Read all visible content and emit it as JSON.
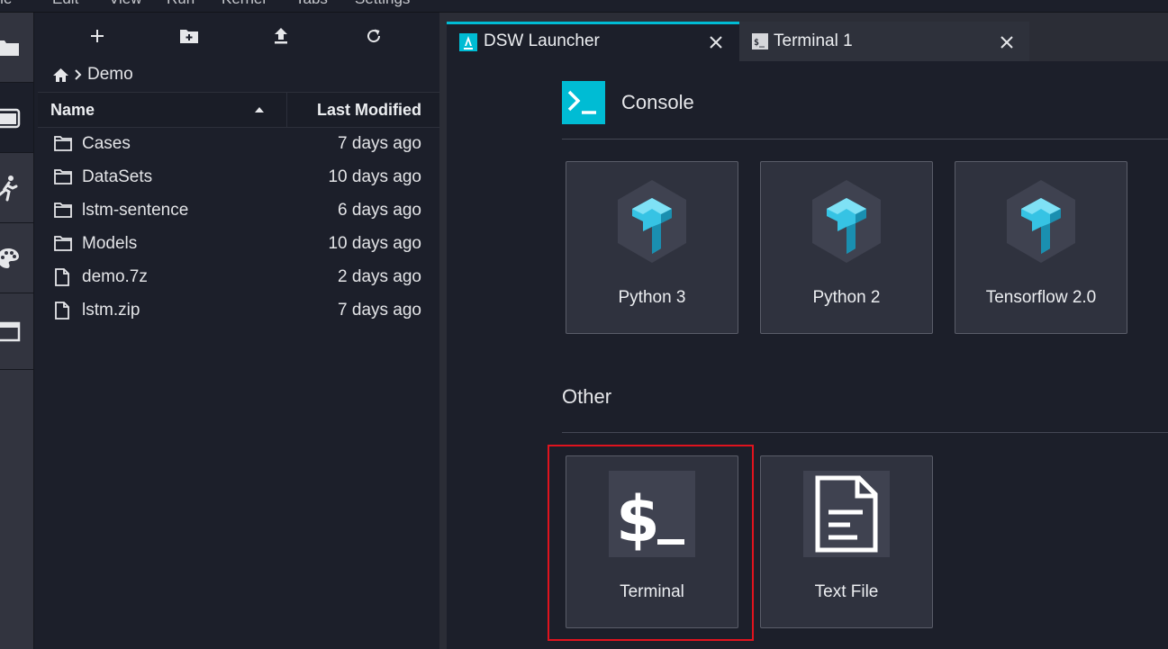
{
  "menu": [
    "File",
    "Edit",
    "View",
    "Run",
    "Kernel",
    "Tabs",
    "Settings"
  ],
  "activity_bar": [
    {
      "id": "files",
      "icon": "folder-icon"
    },
    {
      "id": "file-browser",
      "icon": "folder-tab-icon"
    },
    {
      "id": "running",
      "icon": "running-icon"
    },
    {
      "id": "commands",
      "icon": "palette-icon"
    },
    {
      "id": "tabs",
      "icon": "tabs-icon"
    }
  ],
  "file_browser": {
    "toolbar": [
      {
        "icon": "plus-icon"
      },
      {
        "icon": "new-folder-icon"
      },
      {
        "icon": "upload-icon"
      },
      {
        "icon": "refresh-icon"
      }
    ],
    "breadcrumb": {
      "home_icon": "home-icon",
      "separator_icon": "chevron-right-icon",
      "folder": "Demo"
    },
    "columns": {
      "name": "Name",
      "last_modified": "Last Modified"
    },
    "files": [
      {
        "name": "Cases",
        "modified": "7 days ago",
        "type": "folder"
      },
      {
        "name": "DataSets",
        "modified": "10 days ago",
        "type": "folder"
      },
      {
        "name": "lstm-sentence",
        "modified": "6 days ago",
        "type": "folder"
      },
      {
        "name": "Models",
        "modified": "10 days ago",
        "type": "folder"
      },
      {
        "name": "demo.7z",
        "modified": "2 days ago",
        "type": "file"
      },
      {
        "name": "lstm.zip",
        "modified": "7 days ago",
        "type": "file"
      }
    ]
  },
  "tabs": [
    {
      "label": "DSW Launcher",
      "icon": "launcher-icon",
      "active": true
    },
    {
      "label": "Terminal 1",
      "icon": "terminal-tab-icon",
      "active": false
    }
  ],
  "launcher": {
    "console": {
      "title": "Console",
      "icon": "console-icon",
      "items": [
        {
          "label": "Python 3",
          "icon": "tensorflow-icon"
        },
        {
          "label": "Python 2",
          "icon": "tensorflow-icon"
        },
        {
          "label": "Tensorflow 2.0",
          "icon": "tensorflow-icon"
        }
      ]
    },
    "other": {
      "title": "Other",
      "items": [
        {
          "label": "Terminal",
          "icon": "terminal-icon"
        },
        {
          "label": "Text File",
          "icon": "text-file-icon"
        }
      ]
    }
  },
  "colors": {
    "accent": "#00bcd4",
    "background": "#1c1f2a",
    "panel": "#2f323e",
    "highlight": "#e0131e"
  }
}
